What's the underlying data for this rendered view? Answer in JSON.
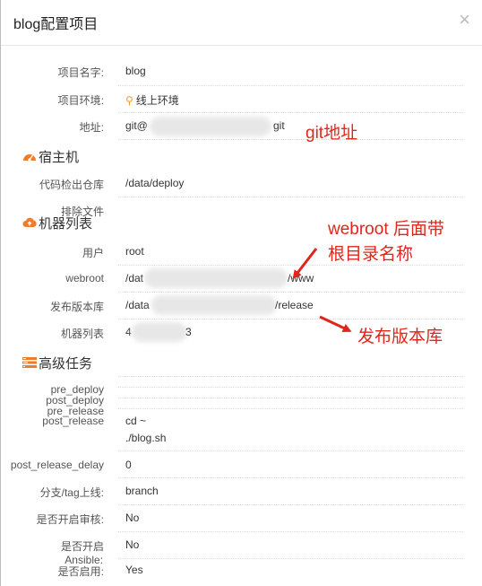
{
  "dialog": {
    "title": "blog配置项目",
    "close": "×"
  },
  "fields": {
    "project_name": {
      "label": "项目名字:",
      "value": "blog"
    },
    "project_env": {
      "label": "项目环境:",
      "value": "线上环境"
    },
    "address": {
      "label": "地址:",
      "value_prefix": "git@",
      "value_suffix": "git"
    },
    "checkout_repo": {
      "label": "代码检出仓库",
      "value": "/data/deploy"
    },
    "exclude_files": {
      "label": "排除文件"
    },
    "user": {
      "label": "用户",
      "value": "root"
    },
    "webroot": {
      "label": "webroot",
      "value_prefix": "/dat",
      "value_suffix": "/www"
    },
    "release_repo": {
      "label": "发布版本库",
      "value_prefix": "/data",
      "value_suffix": "/release"
    },
    "machine_list": {
      "label": "机器列表",
      "value_prefix": "4",
      "value_suffix": "3"
    },
    "pre_deploy": {
      "label": "pre_deploy"
    },
    "post_deploy": {
      "label": "post_deploy"
    },
    "pre_release": {
      "label": "pre_release"
    },
    "post_release": {
      "label": "post_release",
      "value_line1": "cd ~",
      "value_line2": "./blog.sh"
    },
    "post_release_delay": {
      "label": "post_release_delay",
      "value": "0"
    },
    "branch_tag": {
      "label": "分支/tag上线:",
      "value": "branch"
    },
    "audit": {
      "label": "是否开启审核:",
      "value": "No"
    },
    "enable": {
      "label": "是否开启",
      "value": "No"
    },
    "ansible": {
      "label": "Ansible:"
    },
    "enabled": {
      "label": "是否启用:",
      "value": "Yes"
    }
  },
  "sections": {
    "host": "宿主机",
    "machines": "机器列表",
    "advanced": "高级任务"
  },
  "annotations": {
    "git": "git地址",
    "webroot_line1": "webroot 后面带",
    "webroot_line2": "根目录名称",
    "release": "发布版本库"
  },
  "colors": {
    "accent_red": "#e1251b",
    "section_icon": "#f07c2a",
    "location_pin": "#f0a020"
  }
}
